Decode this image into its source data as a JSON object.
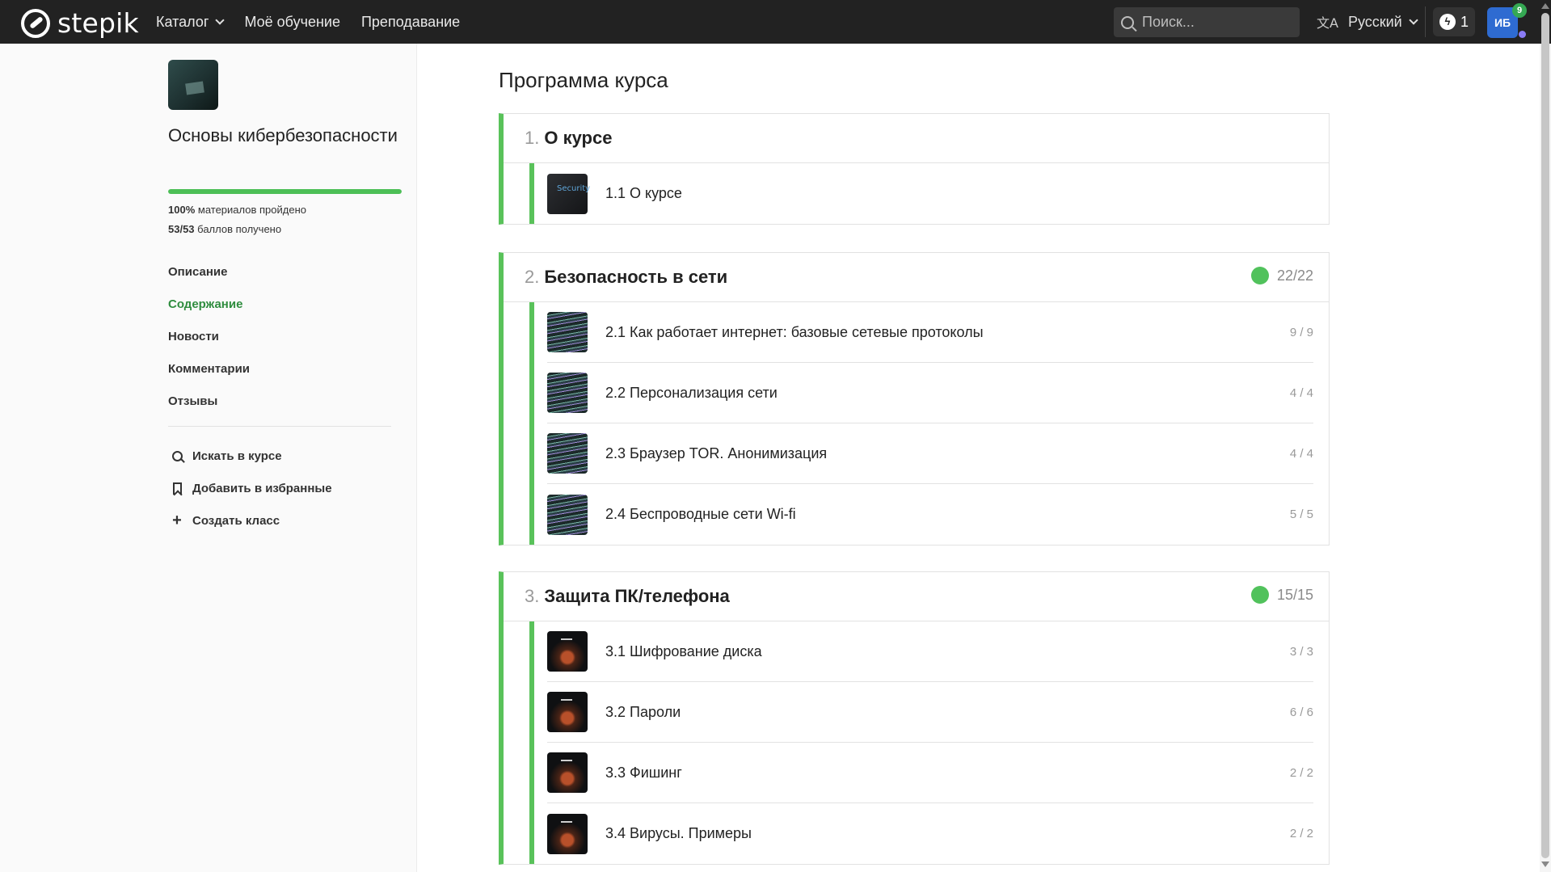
{
  "header": {
    "logo_text": "stepik",
    "nav": [
      {
        "label": "Каталог",
        "has_dropdown": true
      },
      {
        "label": "Моё обучение",
        "has_dropdown": false
      },
      {
        "label": "Преподавание",
        "has_dropdown": false
      }
    ],
    "search_placeholder": "Поиск...",
    "language": "Русский",
    "streak_count": "1",
    "avatar_initials": "ИБ",
    "notifications_count": "9"
  },
  "sidebar": {
    "course_title": "Основы кибербезопасности",
    "progress_fraction": 1.0,
    "materials_value": "100%",
    "materials_text": "материалов пройдено",
    "points_value": "53/53",
    "points_text": "баллов получено",
    "links": [
      {
        "label": "Описание",
        "active": false
      },
      {
        "label": "Содержание",
        "active": true
      },
      {
        "label": "Новости",
        "active": false
      },
      {
        "label": "Комментарии",
        "active": false
      },
      {
        "label": "Отзывы",
        "active": false
      }
    ],
    "actions": [
      {
        "label": "Искать в курсе",
        "icon": "search-icon"
      },
      {
        "label": "Добавить в избранные",
        "icon": "bookmark-icon"
      },
      {
        "label": "Создать класс",
        "icon": "plus-icon"
      }
    ]
  },
  "main": {
    "title": "Программа курса",
    "modules": [
      {
        "num": "1.",
        "title": "О курсе",
        "score": "",
        "lessons": [
          {
            "title": "1.1 О курсе",
            "score": "",
            "thumb": "security"
          }
        ]
      },
      {
        "num": "2.",
        "title": "Безопасность в сети",
        "score": "22/22",
        "lessons": [
          {
            "title": "2.1 Как работает интернет: базовые сетевые протоколы",
            "score": "9 / 9",
            "thumb": "code"
          },
          {
            "title": "2.2 Персонализация сети",
            "score": "4 / 4",
            "thumb": "code"
          },
          {
            "title": "2.3 Браузер TOR. Анонимизация",
            "score": "4 / 4",
            "thumb": "code"
          },
          {
            "title": "2.4 Беспроводные сети Wi-fi",
            "score": "5 / 5",
            "thumb": "code"
          }
        ]
      },
      {
        "num": "3.",
        "title": "Защита ПК/телефона",
        "score": "15/15",
        "lessons": [
          {
            "title": "3.1 Шифрование диска",
            "score": "3 / 3",
            "thumb": "dark"
          },
          {
            "title": "3.2 Пароли",
            "score": "6 / 6",
            "thumb": "dark"
          },
          {
            "title": "3.3 Фишинг",
            "score": "2 / 2",
            "thumb": "dark"
          },
          {
            "title": "3.4 Вирусы. Примеры",
            "score": "2 / 2",
            "thumb": "dark"
          }
        ]
      }
    ]
  },
  "colors": {
    "accent_green": "#59c25a",
    "active_link": "#2f8d3f",
    "topbar": "#222222"
  }
}
